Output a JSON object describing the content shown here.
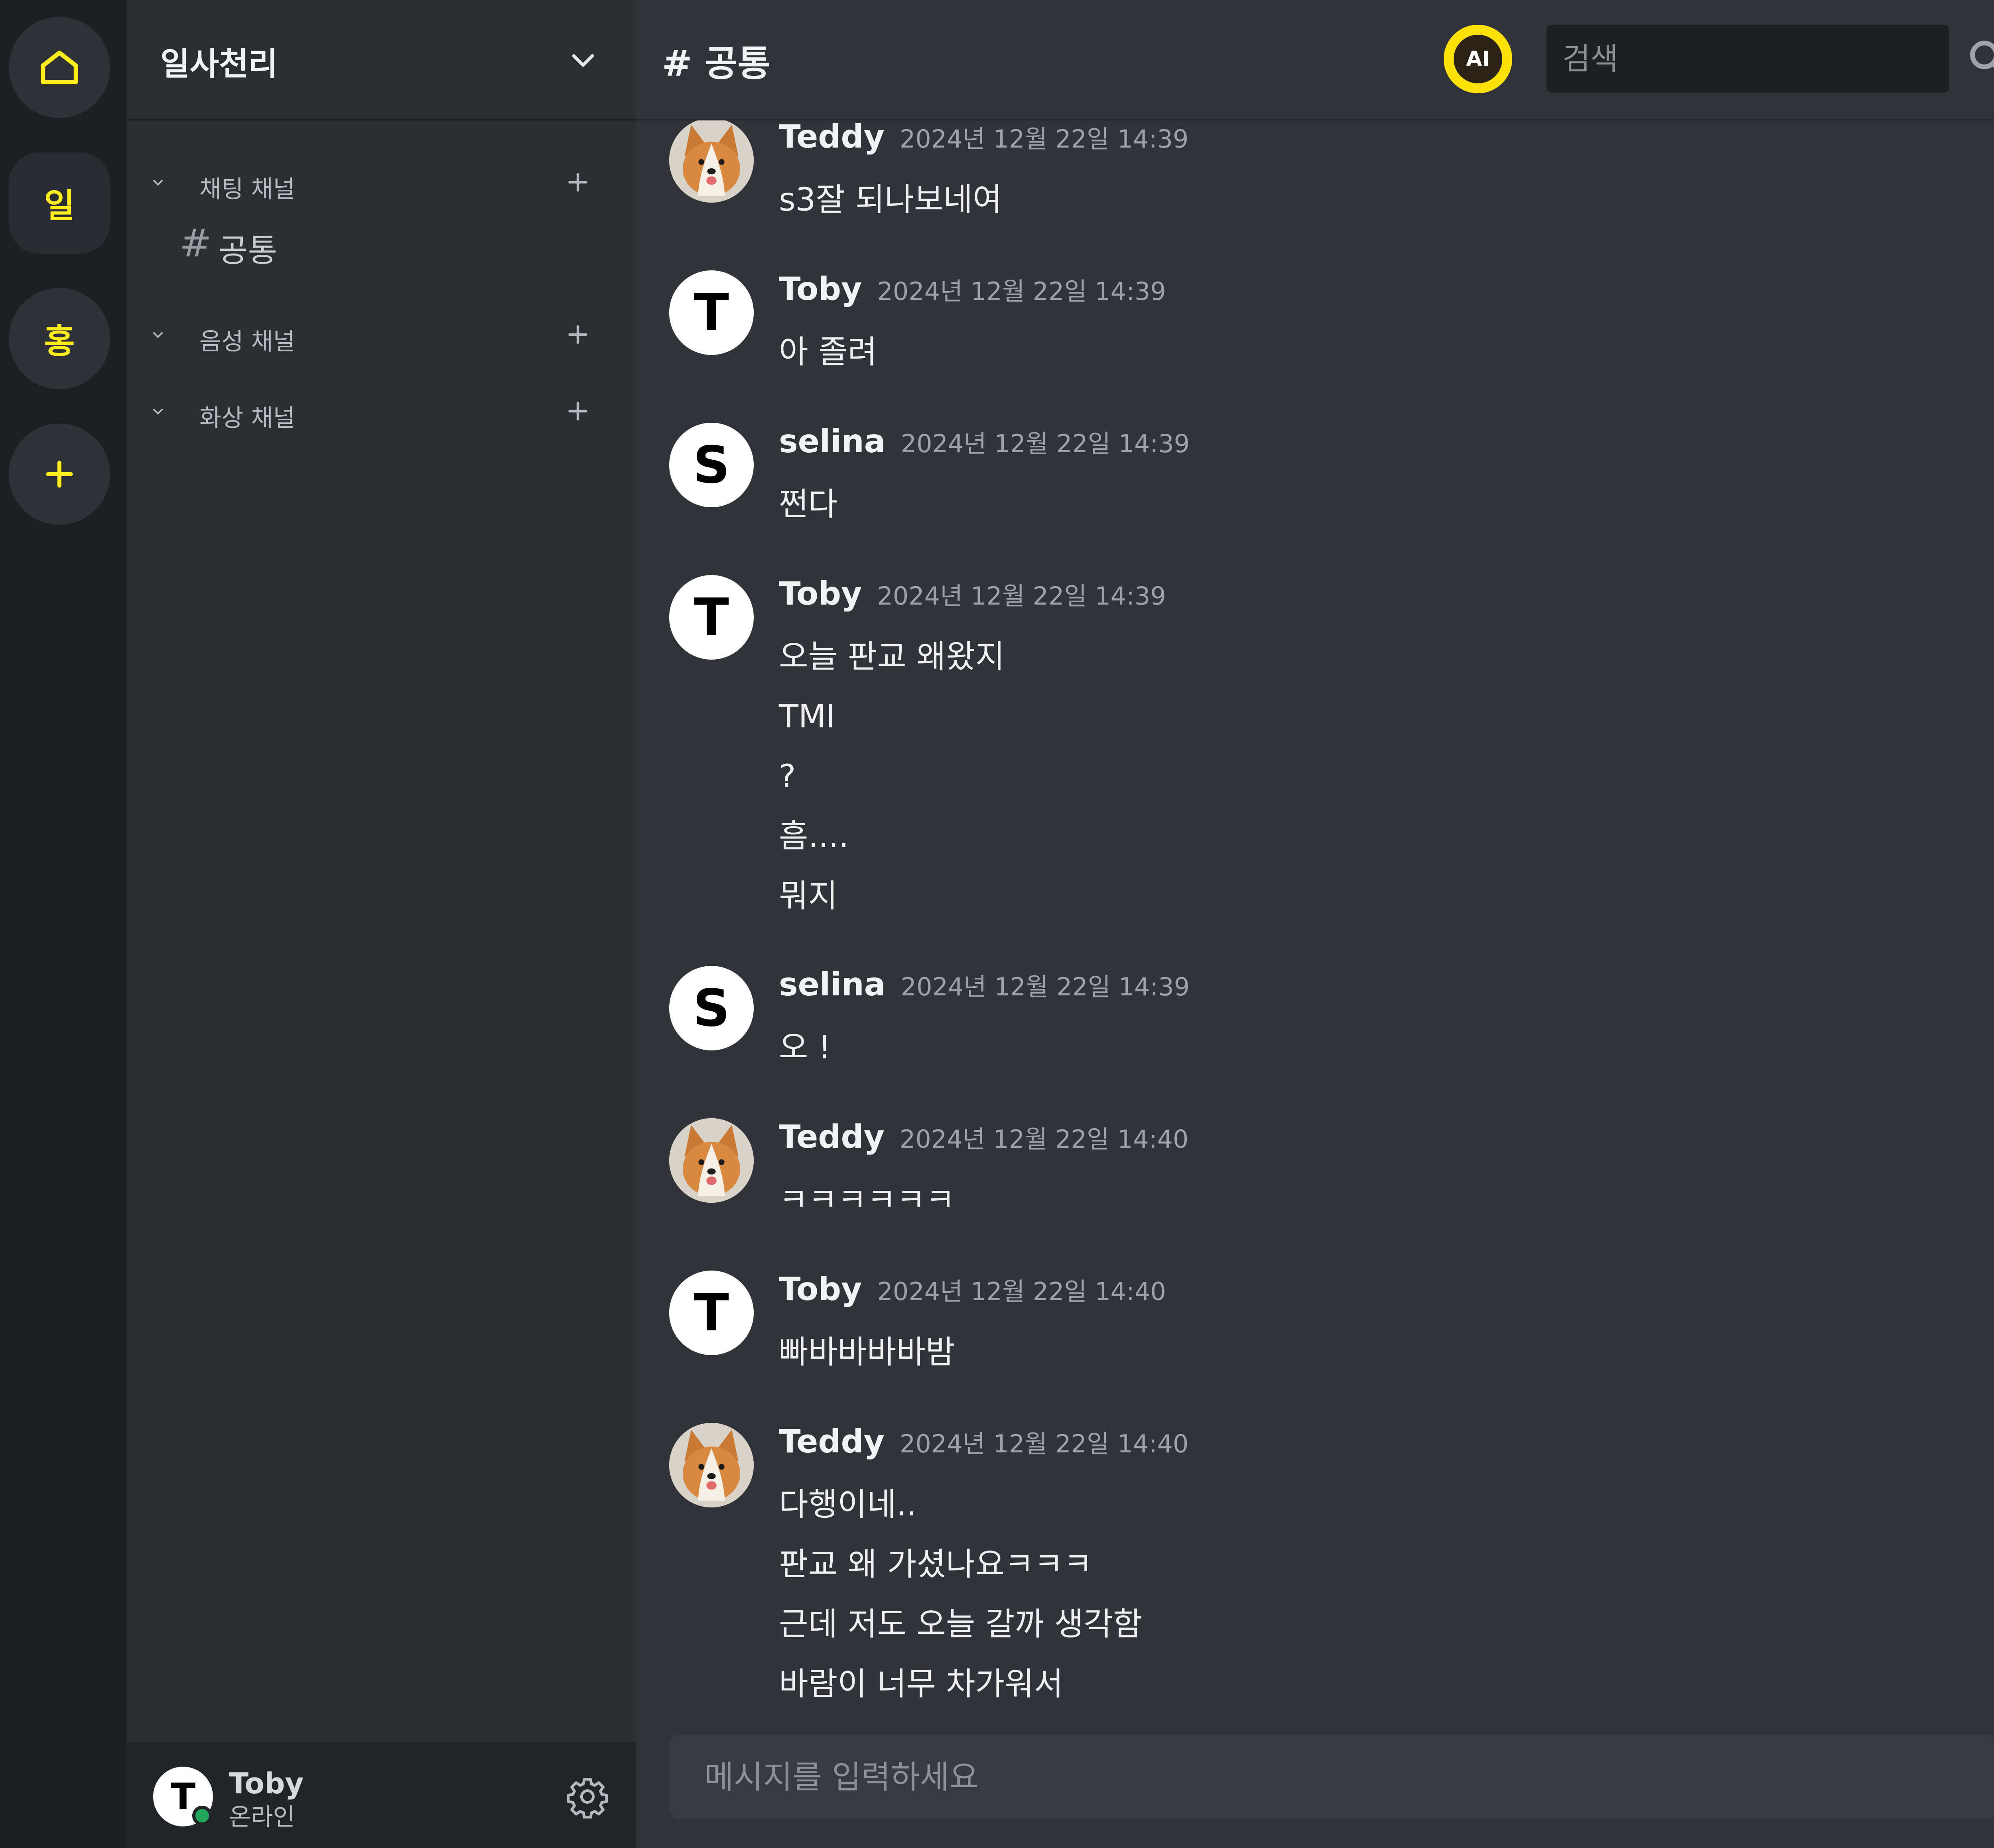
{
  "rail": {
    "home_icon": "home-icon",
    "servers": [
      {
        "label": "일"
      },
      {
        "label": "홍"
      }
    ],
    "add_label": "+"
  },
  "sidebar": {
    "server_name": "일사천리",
    "categories": [
      {
        "label": "채팅 채널"
      },
      {
        "label": "음성 채널"
      },
      {
        "label": "화상 채널"
      }
    ],
    "channel": {
      "hash": "#",
      "label": "공통"
    }
  },
  "user": {
    "initial": "T",
    "name": "Toby",
    "status": "온라인"
  },
  "header": {
    "channel_title": "# 공통",
    "ai_label": "AI",
    "search_placeholder": "검색"
  },
  "messages": [
    {
      "author": "Teddy",
      "avatar": "dog-photo",
      "time": "2024년 12월 22일 14:39",
      "lines": [
        "s3잘 되나보네여"
      ]
    },
    {
      "author": "Toby",
      "avatar_letter": "T",
      "time": "2024년 12월 22일 14:39",
      "lines": [
        "아 졸려"
      ]
    },
    {
      "author": "selina",
      "avatar_letter": "S",
      "time": "2024년 12월 22일 14:39",
      "lines": [
        "쩐다"
      ]
    },
    {
      "author": "Toby",
      "avatar_letter": "T",
      "time": "2024년 12월 22일 14:39",
      "lines": [
        "오늘 판교 왜왔지",
        "TMI",
        "?",
        "흠....",
        "뭐지"
      ]
    },
    {
      "author": "selina",
      "avatar_letter": "S",
      "time": "2024년 12월 22일 14:39",
      "lines": [
        "오 !"
      ]
    },
    {
      "author": "Teddy",
      "avatar": "dog-photo",
      "time": "2024년 12월 22일 14:40",
      "lines": [
        "ㅋㅋㅋㅋㅋㅋ"
      ]
    },
    {
      "author": "Toby",
      "avatar_letter": "T",
      "time": "2024년 12월 22일 14:40",
      "lines": [
        "빠바바바바밤"
      ]
    },
    {
      "author": "Teddy",
      "avatar": "dog-photo",
      "time": "2024년 12월 22일 14:40",
      "lines": [
        "다행이네..",
        "판교 왜 가셨나요ㅋㅋㅋ",
        "근데 저도 오늘 갈까 생각함",
        "바람이 너무 차가워서"
      ]
    }
  ],
  "composer": {
    "placeholder": "메시지를 입력하세요"
  },
  "colors": {
    "accent": "#ffed1f",
    "online": "#23a55a",
    "rail_bg": "#1e1f22",
    "sidebar_bg": "#2b2d31",
    "main_bg": "#313338"
  }
}
